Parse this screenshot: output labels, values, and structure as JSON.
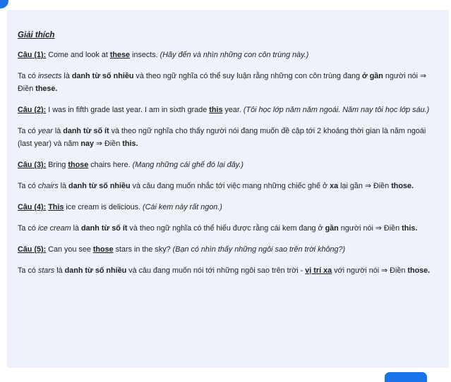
{
  "heading": "Giải thích",
  "items": [
    {
      "label": "Câu (1):",
      "q_before": " Come and look at ",
      "q_word": "these",
      "q_after": " insects. ",
      "q_trans": "(Hãy đến và nhìn những con côn trùng này.)",
      "e_a": "Ta có ",
      "e_noun": "insects",
      "e_b": " là ",
      "e_type": "danh từ số nhiều",
      "e_c": " và theo ngữ nghĩa có thể suy luận rằng những con côn trùng đang ",
      "e_key": "ở gần",
      "e_d": " người nói ⇒ Điền ",
      "e_ans": "these."
    },
    {
      "label": "Câu (2):",
      "q_before": " I was in fifth grade last year. I am in sixth grade ",
      "q_word": "this",
      "q_after": " year. ",
      "q_trans": "(Tôi học lớp năm năm ngoái. Năm nay tôi học lớp sáu.)",
      "e_a": "Ta có ",
      "e_noun": "year",
      "e_b": " là ",
      "e_type": "danh từ số ít",
      "e_c": " và theo ngữ nghĩa cho thấy người nói đang muốn đề cập tới 2 khoảng thời gian là năm ngoái (last year) và năm ",
      "e_key": "nay",
      "e_d": " ⇒ Điền ",
      "e_ans": "this."
    },
    {
      "label": "Câu (3):",
      "q_before": " Bring ",
      "q_word": "those",
      "q_after": " chairs here. ",
      "q_trans": "(Mang những cái ghế đó lại đây.)",
      "e_a": "Ta có ",
      "e_noun": "chairs",
      "e_b": " là ",
      "e_type": "danh từ số nhiều",
      "e_c": " và câu đang muốn nhắc tới việc mang những chiếc ghế ở ",
      "e_key": "xa",
      "e_d": " lại gần ⇒ Điền ",
      "e_ans": "those."
    },
    {
      "label": "Câu (4):",
      "q_before": " ",
      "q_word": "This",
      "q_after": " ice cream is delicious. ",
      "q_trans": "(Cái kem này rất ngon.)",
      "e_a": "Ta có ",
      "e_noun": "ice cream",
      "e_b": " là ",
      "e_type": "danh từ số ít",
      "e_c": " và theo ngữ nghĩa có thể hiểu được rằng cái kem đang ở ",
      "e_key": "gần",
      "e_d": " người nói ⇒ Điền ",
      "e_ans": "this."
    },
    {
      "label": "Câu (5):",
      "q_before": " Can you see ",
      "q_word": "those",
      "q_after": " stars in the sky? ",
      "q_trans": "(Bạn có nhìn thấy những ngôi sao trên trời không?)",
      "e_a": "Ta có ",
      "e_noun": "stars",
      "e_b": " là ",
      "e_type": "danh từ số nhiều",
      "e_c": " và câu đang muốn nói tới những ngôi sao trên trời - ",
      "e_key": "vị trí xa",
      "e_d": " với người nói ⇒ Điền ",
      "e_ans": "those."
    }
  ]
}
